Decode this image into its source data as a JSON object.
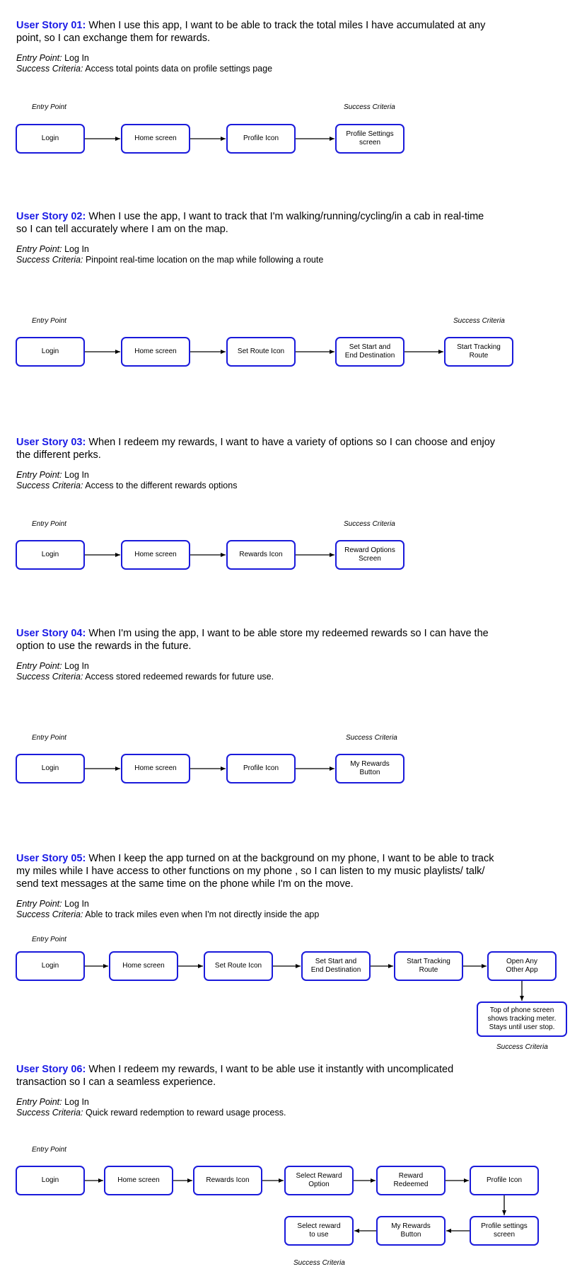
{
  "stories": [
    {
      "number": "User Story 01:",
      "text": "When I use this app, I want to be able to track the total miles I have accumulated at any point, so I can exchange them for rewards.",
      "entry_label": "Entry Point:",
      "entry_value": "Log In",
      "success_label": "Success Criteria:",
      "success_value": "Access total points data on profile settings page"
    },
    {
      "number": "User Story 02:",
      "text": "When I use the app, I want to track that I'm walking/running/cycling/in a cab in real-time so I can tell accurately where I am on the map.",
      "entry_label": "Entry Point:",
      "entry_value": "Log In",
      "success_label": "Success Criteria:",
      "success_value": "Pinpoint real-time location on the map while following a route"
    },
    {
      "number": "User Story 03:",
      "text": "When I redeem my rewards, I want to have a variety of options so I can choose and enjoy the different perks.",
      "entry_label": "Entry Point:",
      "entry_value": "Log In",
      "success_label": "Success Criteria:",
      "success_value": "Access to the different rewards options"
    },
    {
      "number": "User Story 04:",
      "text": "When I'm using the app, I want to be able store my redeemed rewards so I can have the option to use the rewards in the future.",
      "entry_label": "Entry Point:",
      "entry_value": "Log In",
      "success_label": "Success Criteria:",
      "success_value": "Access stored redeemed rewards for future use."
    },
    {
      "number": "User Story 05:",
      "text": "When I keep the app turned on at the background on my phone, I want to be able to track my miles while I have access to other functions on my phone , so I can listen to my music playlists/ talk/ send text messages at the same time on the phone while I'm on the move.",
      "entry_label": "Entry Point:",
      "entry_value": "Log In",
      "success_label": "Success Criteria:",
      "success_value": "Able to track miles even when I'm not directly inside the app"
    },
    {
      "number": "User Story 06:",
      "text": "When I redeem my rewards, I want to be able use it instantly with uncomplicated transaction so I can a seamless experience.",
      "entry_label": "Entry Point:",
      "entry_value": "Log In",
      "success_label": "Success Criteria:",
      "success_value": "Quick reward redemption to reward usage process."
    }
  ],
  "flow_labels": {
    "entry": "Entry Point",
    "success": "Success Criteria"
  },
  "flows": [
    [
      "Login",
      "Home screen",
      "Profile Icon",
      "Profile Settings\nscreen"
    ],
    [
      "Login",
      "Home screen",
      "Set Route Icon",
      "Set Start and\nEnd Destination",
      "Start Tracking\nRoute"
    ],
    [
      "Login",
      "Home screen",
      "Rewards Icon",
      "Reward Options\nScreen"
    ],
    [
      "Login",
      "Home screen",
      "Profile Icon",
      "My Rewards\nButton"
    ],
    [
      "Login",
      "Home screen",
      "Set Route Icon",
      "Set Start and\nEnd Destination",
      "Start Tracking\nRoute",
      "Open Any\nOther App",
      "Top of phone screen\nshows tracking meter.\nStays until user stop."
    ],
    [
      "Login",
      "Home screen",
      "Rewards Icon",
      "Select Reward\nOption",
      "Reward\nRedeemed",
      "Profile Icon",
      "Profile settings\nscreen",
      "My Rewards\nButton",
      "Select reward\nto use"
    ]
  ],
  "colors": {
    "accent": "#1a1ae6",
    "box_border": "#1a1adb"
  }
}
